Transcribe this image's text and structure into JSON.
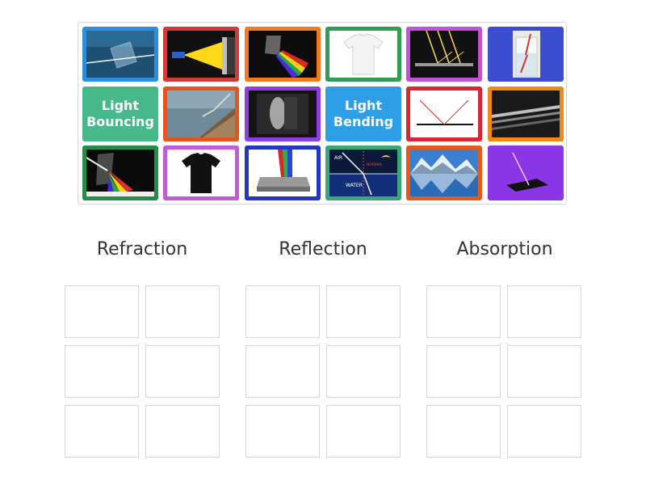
{
  "text_cards": {
    "light_bouncing": "Light\nBouncing",
    "light_bending": "Light\nBending"
  },
  "diagram_labels": {
    "air": "AIR",
    "normal": "NORMAL",
    "water": "WATER"
  },
  "columns": {
    "refraction": "Refraction",
    "reflection": "Reflection",
    "absorption": "Absorption"
  },
  "colors": {
    "blue": "#2d8fdc",
    "red": "#d23a34",
    "orange": "#f07c1e",
    "green": "#2f9e52",
    "violet": "#bf54d6",
    "royal": "#3b4ecf",
    "teal": "#47b889",
    "orange_red": "#e4541e",
    "purple": "#8c3fdc",
    "light_blue": "#2e9ee6",
    "crimson": "#d8253a",
    "amber": "#f08a16",
    "forest": "#238d4b",
    "magenta": "#c35ad8",
    "navy": "#2536c1",
    "sea": "#3aa777",
    "rust": "#e35a1c",
    "grape": "#8b36e6"
  }
}
